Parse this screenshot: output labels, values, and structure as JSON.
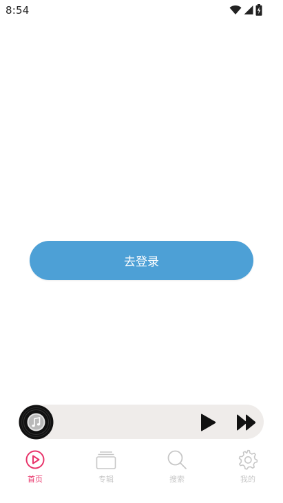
{
  "status_bar": {
    "time": "8:54"
  },
  "main": {
    "login_button_label": "去登录"
  },
  "player": {
    "cover_icon": "vinyl-record-icon",
    "play_icon": "play-icon",
    "next_icon": "fast-forward-icon"
  },
  "tabs": [
    {
      "label": "首页",
      "icon": "play-circle-icon",
      "active": true
    },
    {
      "label": "专辑",
      "icon": "album-stack-icon",
      "active": false
    },
    {
      "label": "搜索",
      "icon": "search-icon",
      "active": false
    },
    {
      "label": "我的",
      "icon": "gear-icon",
      "active": false
    }
  ],
  "colors": {
    "accent": "#e8346a",
    "button": "#4da0d6",
    "player_background": "#efecea",
    "inactive": "#c7c7c7"
  }
}
